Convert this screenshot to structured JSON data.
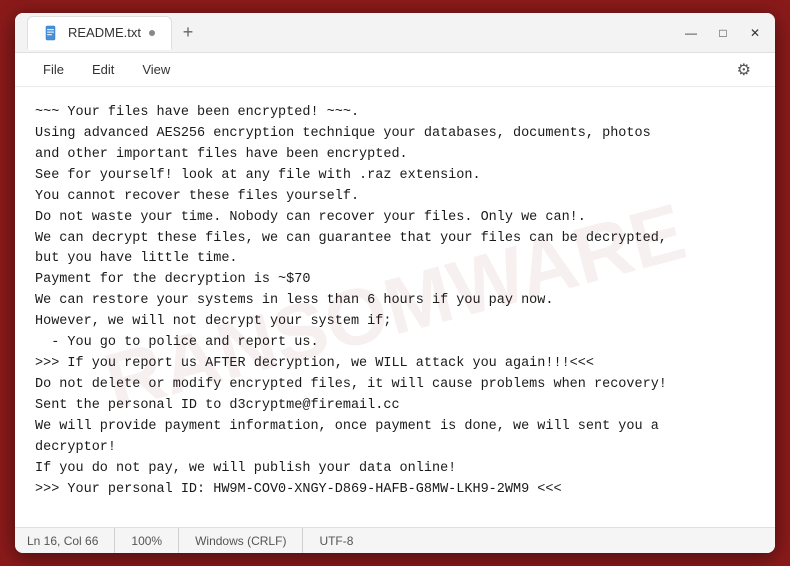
{
  "window": {
    "title": "README.txt",
    "tab_icon": "📄",
    "controls": {
      "minimize": "—",
      "maximize": "□",
      "close": "✕"
    }
  },
  "menubar": {
    "items": [
      "File",
      "Edit",
      "View"
    ],
    "settings_icon": "⚙"
  },
  "content": {
    "text": "~~~ Your files have been encrypted! ~~~.\nUsing advanced AES256 encryption technique your databases, documents, photos\nand other important files have been encrypted.\nSee for yourself! look at any file with .raz extension.\nYou cannot recover these files yourself.\nDo not waste your time. Nobody can recover your files. Only we can!.\nWe can decrypt these files, we can guarantee that your files can be decrypted,\nbut you have little time.\nPayment for the decryption is ~$70\nWe can restore your systems in less than 6 hours if you pay now.\nHowever, we will not decrypt your system if;\n  - You go to police and report us.\n>>> If you report us AFTER decryption, we WILL attack you again!!!<<<\nDo not delete or modify encrypted files, it will cause problems when recovery!\nSent the personal ID to d3cryptme@firemail.cc\nWe will provide payment information, once payment is done, we will sent you a\ndecryptor!\nIf you do not pay, we will publish your data online!\n>>> Your personal ID: HW9M-COV0-XNGY-D869-HAFB-G8MW-LKH9-2WM9 <<<"
  },
  "statusbar": {
    "line_col": "Ln 16, Col 66",
    "zoom": "100%",
    "line_ending": "Windows (CRLF)",
    "encoding": "UTF-8"
  }
}
